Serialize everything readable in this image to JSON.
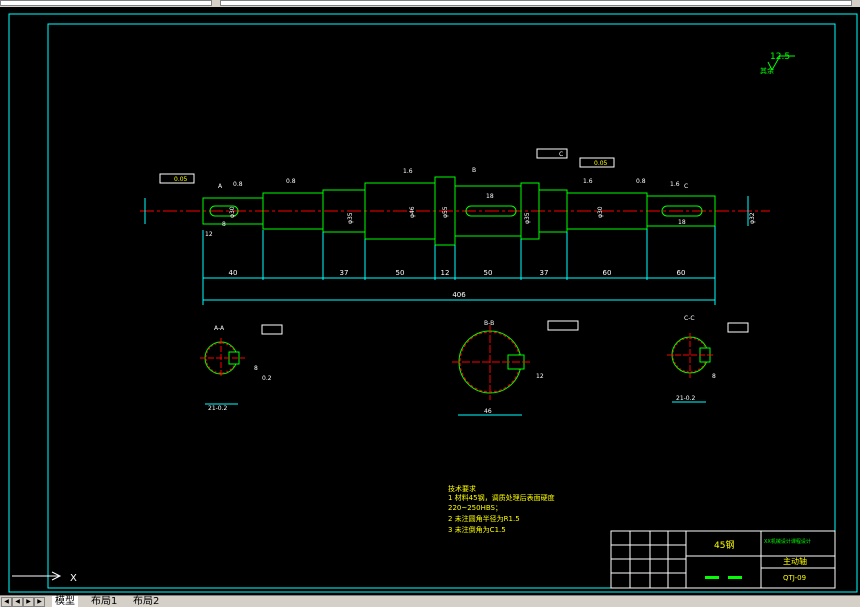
{
  "tabs": [
    {
      "label": "模型"
    },
    {
      "label": "布局1"
    },
    {
      "label": "布局2"
    }
  ],
  "drawing": {
    "roughness": "12.5",
    "roughness_note": "其余",
    "tolerance_1": "0.05",
    "tolerance_2": "0.05",
    "datum": "C",
    "roughness_marks": [
      "0.8",
      "0.8",
      "1.6",
      "1.6",
      "0.8",
      "1.6"
    ],
    "section_labels": {
      "a": "A",
      "b": "B",
      "c": "C"
    },
    "dims_bottom": [
      "40",
      "37",
      "50",
      "12",
      "50",
      "37",
      "60",
      "60"
    ],
    "total_length": "406",
    "dia_left": "φ30",
    "dia_mid1": "φ35",
    "dia_center": "φ46",
    "dia_collar": "φ55",
    "dia_right1": "φ35",
    "dia_right2": "φ30",
    "dia_end": "φ32",
    "keyway_18a": "18",
    "keyway_18b": "18",
    "keyway_12": "12",
    "keyway_8": "8",
    "sections": {
      "aa": {
        "title": "A-A",
        "dim": "21-0.2",
        "side": "8",
        "tol": "0.2"
      },
      "bb": {
        "title": "B-B",
        "dim": "46",
        "side": "12"
      },
      "cc": {
        "title": "C-C",
        "dim": "21-0.2",
        "side": "8"
      }
    }
  },
  "notes": {
    "title": "技术要求",
    "lines": [
      "1 材料45钢，调质处理后表面硬度",
      "220~250HBS；",
      "2 未注圆角半径为R1.5",
      "3 未注倒角为C1.5"
    ]
  },
  "title_block": {
    "material": "45钢",
    "school": "XX机械设计课程设计",
    "part_name": "主动轴",
    "drawing_no": "QTJ-09"
  },
  "ucs": {
    "x_label": "X"
  }
}
